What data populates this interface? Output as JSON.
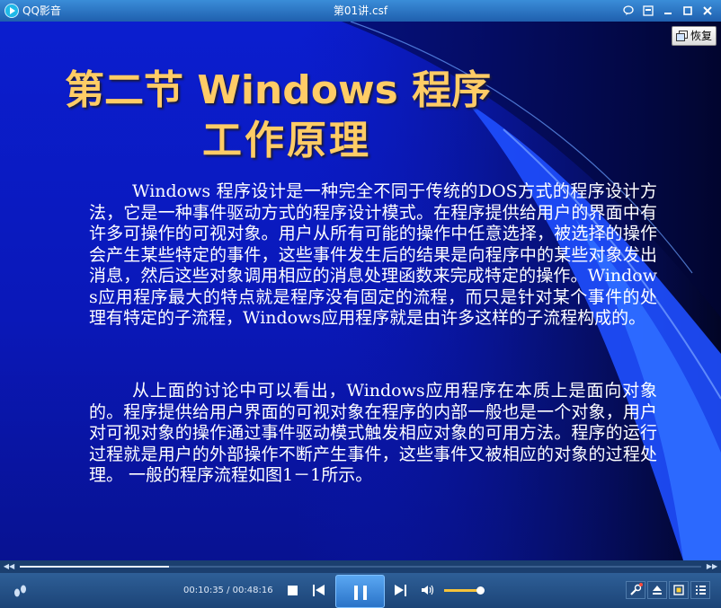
{
  "titlebar": {
    "app_name": "QQ影音",
    "window_title": "第01讲.csf",
    "buttons": [
      "chat-icon",
      "skin-icon",
      "minimize-icon",
      "maximize-icon",
      "close-icon"
    ]
  },
  "overlay": {
    "restore_label": "恢复"
  },
  "slide": {
    "title_line1": "第二节  Windows 程序",
    "title_line2": "工作原理",
    "paragraph1": "Windows 程序设计是一种完全不同于传统的DOS方式的程序设计方法，它是一种事件驱动方式的程序设计模式。在程序提供给用户的界面中有许多可操作的可视对象。用户从所有可能的操作中任意选择，被选择的操作会产生某些特定的事件，这些事件发生后的结果是向程序中的某些对象发出消息，然后这些对象调用相应的消息处理函数来完成特定的操作。Windows应用程序最大的特点就是程序没有固定的流程，而只是针对某个事件的处理有特定的子流程，Windows应用程序就是由许多这样的子流程构成的。",
    "paragraph2": "从上面的讨论中可以看出，Windows应用程序在本质上是面向对象的。程序提供给用户界面的可视对象在程序的内部一般也是一个对象，用户对可视对象的操作通过事件驱动模式触发相应对象的可用方法。程序的运行过程就是用户的外部操作不断产生事件，这些事件又被相应的对象的过程处理。 一般的程序流程如图1－1所示。"
  },
  "player": {
    "time_display": "00:10:35 / 00:48:16",
    "progress_fraction": 0.219,
    "volume_fraction": 0.95,
    "colors": {
      "accent": "#2a73c8",
      "volume": "#f6c33a",
      "title_text": "#ffcc66"
    }
  }
}
